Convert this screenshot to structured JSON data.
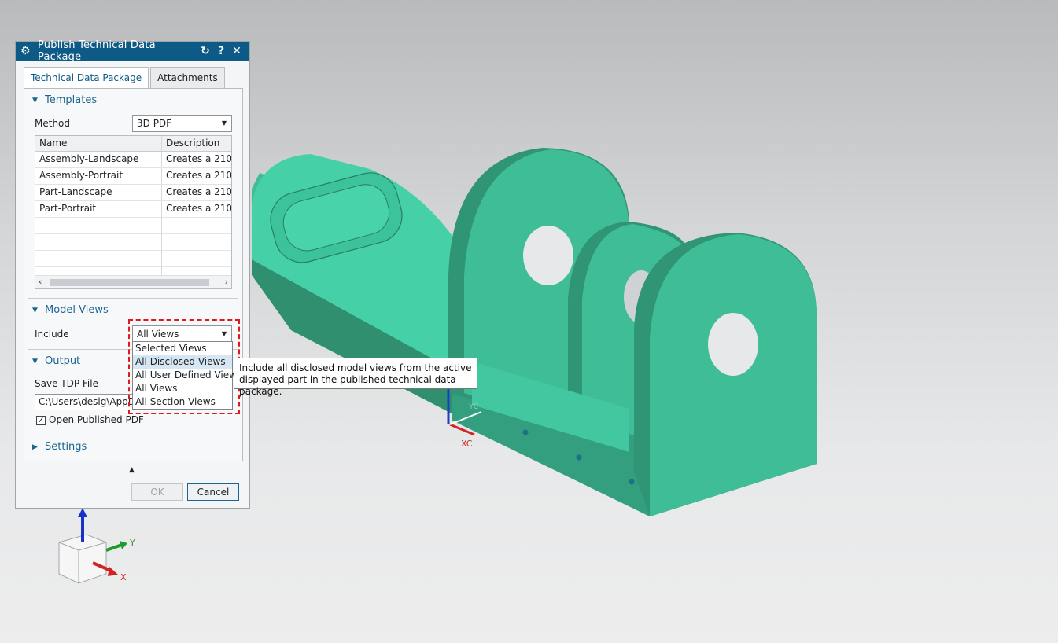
{
  "dialog": {
    "title": "Publish Technical Data Package",
    "tabs": [
      "Technical Data Package",
      "Attachments"
    ],
    "templates": {
      "heading": "Templates",
      "method_label": "Method",
      "method_value": "3D PDF",
      "columns": [
        "Name",
        "Description"
      ],
      "rows": [
        {
          "name": "Assembly-Landscape",
          "description": "Creates a 210..."
        },
        {
          "name": "Assembly-Portrait",
          "description": "Creates a 210..."
        },
        {
          "name": "Part-Landscape",
          "description": "Creates a 210..."
        },
        {
          "name": "Part-Portrait",
          "description": "Creates a 210..."
        }
      ]
    },
    "model_views": {
      "heading": "Model Views",
      "include_label": "Include",
      "include_value": "All Views",
      "options": [
        "Selected Views",
        "All Disclosed Views",
        "All User Defined Views",
        "All Views",
        "All Section Views"
      ],
      "highlighted_option": "All Disclosed Views"
    },
    "output": {
      "heading": "Output",
      "save_label": "Save TDP File",
      "save_value": "C:\\Users\\desig\\AppData",
      "open_pdf_label": "Open Published PDF",
      "open_pdf_checked": "✓"
    },
    "settings": {
      "heading": "Settings"
    },
    "buttons": {
      "ok": "OK",
      "cancel": "Cancel"
    }
  },
  "tooltip": {
    "line1": "Include all disclosed model views from the active",
    "line2": "displayed part in the published technical data package."
  },
  "viewport": {
    "wcs_labels": {
      "xc": "XC",
      "yc": "YC"
    },
    "triad_labels": {
      "x": "X",
      "y": "Y"
    },
    "model_color": "#3fb792",
    "accent": "#0e5a86",
    "highlight_border": "#e01a1a"
  }
}
